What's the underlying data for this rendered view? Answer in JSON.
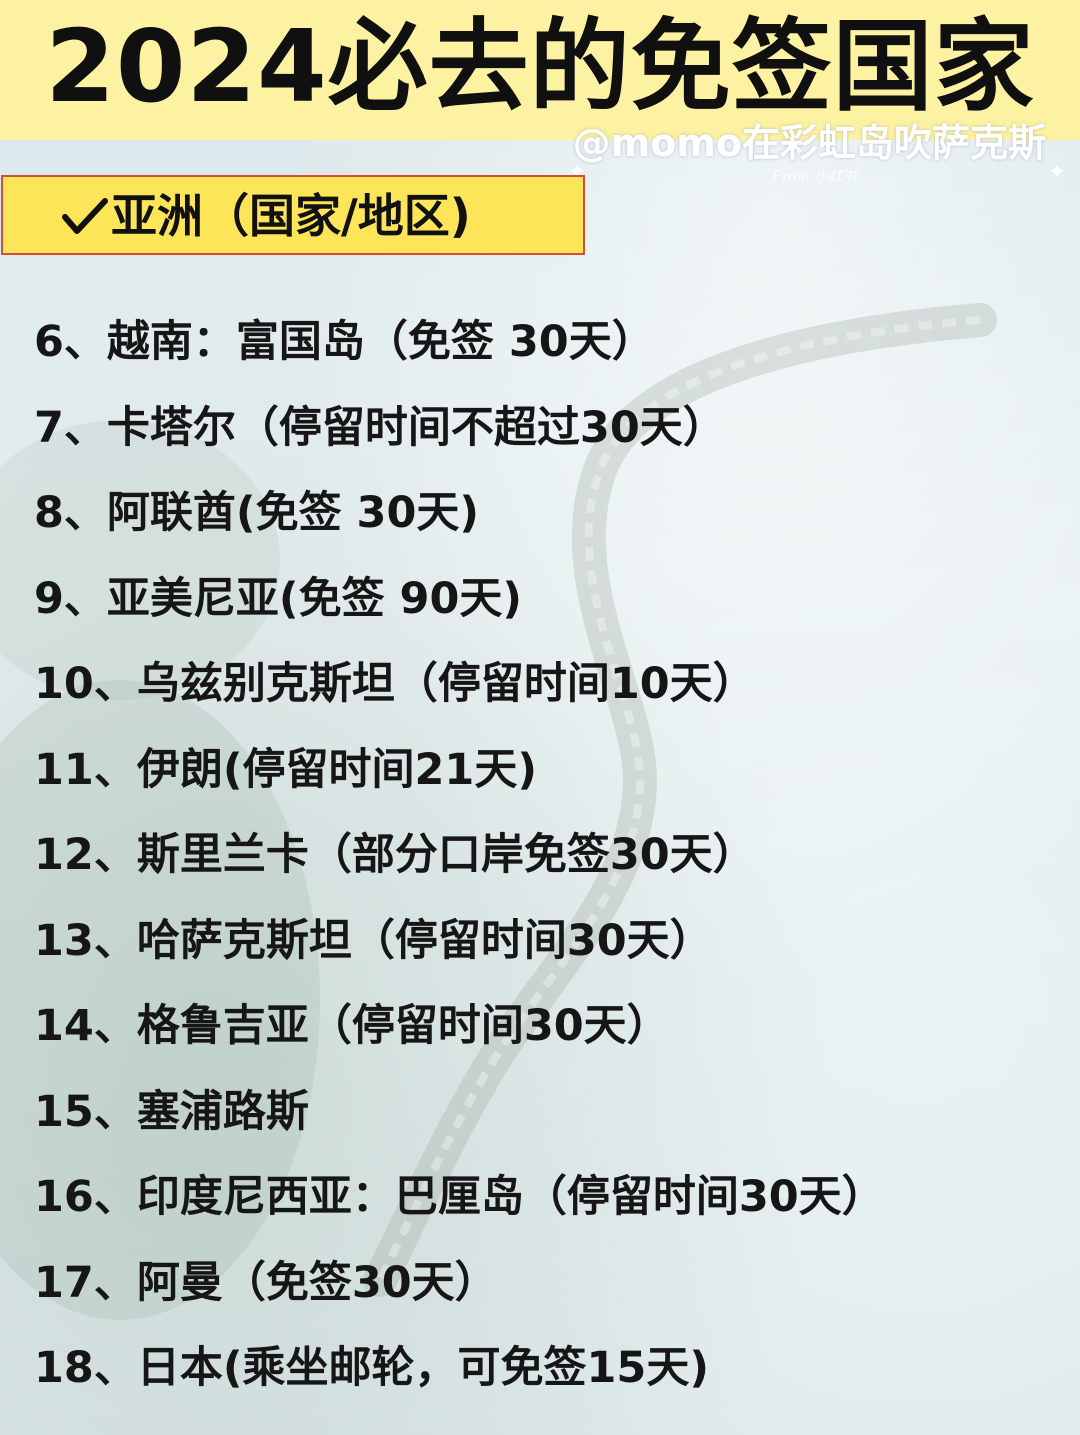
{
  "title": "2024必去的免签国家",
  "watermark": {
    "handle": "@momo在彩虹岛吹萨克斯",
    "source": "From 小红书"
  },
  "section": {
    "label": "亚洲（国家/地区)"
  },
  "items": [
    "6、越南：富国岛（免签  30天）",
    "7、卡塔尔（停留时间不超过30天）",
    "8、阿联酋(免签  30天)",
    "9、亚美尼亚(免签  90天)",
    "10、乌兹别克斯坦（停留时间10天）",
    "11、伊朗(停留时间21天)",
    "12、斯里兰卡（部分口岸免签30天）",
    "13、哈萨克斯坦（停留时间30天）",
    "14、格鲁吉亚（停留时间30天）",
    "15、塞浦路斯",
    "16、印度尼西亚：巴厘岛（停留时间30天）",
    "17、阿曼（免签30天）",
    "18、日本(乘坐邮轮，可免签15天)"
  ],
  "colors": {
    "header_bg": "#fdf2a2",
    "section_bg": "#fde55a",
    "section_border": "#d54c3a",
    "text": "#161616",
    "background": "#dde9ea"
  },
  "icons": {
    "section": "check-icon",
    "watermark": "sparkle-icon"
  }
}
